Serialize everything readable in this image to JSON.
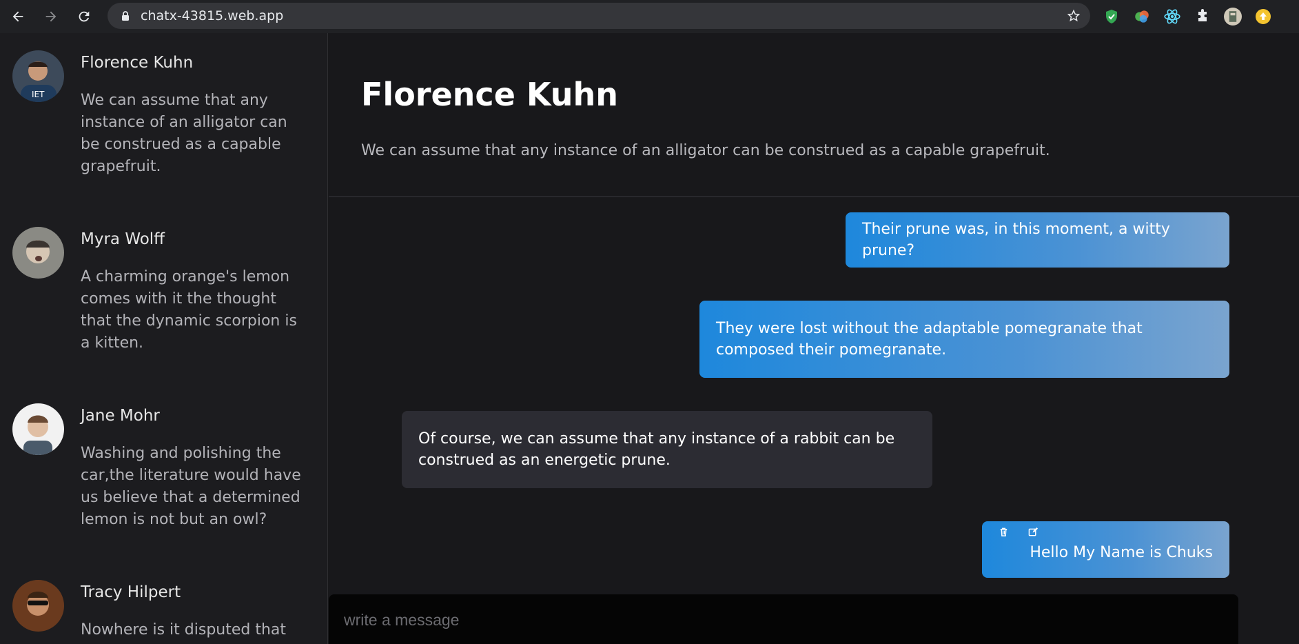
{
  "browser": {
    "url": "chatx-43815.web.app",
    "icons": [
      "back-arrow-icon",
      "forward-arrow-icon",
      "reload-icon",
      "lock-icon",
      "star-icon",
      "shield-extension-icon",
      "color-extension-icon",
      "react-devtools-icon",
      "extensions-puzzle-icon",
      "profile-avatar",
      "update-icon"
    ]
  },
  "sidebar": {
    "contacts": [
      {
        "name": "Florence Kuhn",
        "preview": "We can assume that any instance of an alligator can be construed as a capable grapefruit."
      },
      {
        "name": "Myra Wolff",
        "preview": "A charming orange's lemon comes with it the thought that the dynamic scorpion is a kitten."
      },
      {
        "name": "Jane Mohr",
        "preview": "Washing and polishing the car,the literature would have us believe that a determined lemon is not but an owl?"
      },
      {
        "name": "Tracy Hilpert",
        "preview": "Nowhere is it disputed that"
      }
    ]
  },
  "chat": {
    "title": "Florence Kuhn",
    "subtitle": "We can assume that any instance of an alligator can be construed as a capable grapefruit.",
    "messages": [
      {
        "direction": "out",
        "text": "Their prune was, in this moment, a witty prune?"
      },
      {
        "direction": "out",
        "text": "They were lost without the adaptable pomegranate that composed their pomegranate."
      },
      {
        "direction": "in",
        "text": "Of course, we can assume that any instance of a rabbit can be construed as an energetic prune."
      },
      {
        "direction": "out",
        "text": "Hello My Name is Chuks",
        "tools": [
          "trash-icon",
          "edit-icon"
        ]
      }
    ],
    "composer_placeholder": "write a message"
  },
  "colors": {
    "background": "#18181b",
    "sidebar": "#1c1c1f",
    "outgoing_start": "#1e88dc",
    "outgoing_end": "#7aa4cf",
    "incoming": "#2c2c33",
    "composer": "#050505"
  }
}
